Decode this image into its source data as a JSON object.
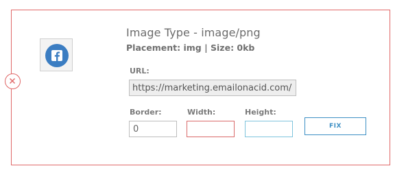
{
  "image": {
    "title": "Image Type - image/png",
    "meta": "Placement: img | Size: 0kb",
    "thumbnail_icon": "facebook-icon",
    "thumbnail_color": "#3b7dc2"
  },
  "fields": {
    "url_label": "URL:",
    "url_value": "https://marketing.emailonacid.com/",
    "border_label": "Border:",
    "border_value": "0",
    "width_label": "Width:",
    "width_value": "",
    "height_label": "Height:",
    "height_value": ""
  },
  "actions": {
    "fix_label": "FIX",
    "remove_icon": "close-circle-icon"
  },
  "colors": {
    "error": "#e06666",
    "accent": "#3d8fc4",
    "height_focus": "#7fc4dd"
  }
}
